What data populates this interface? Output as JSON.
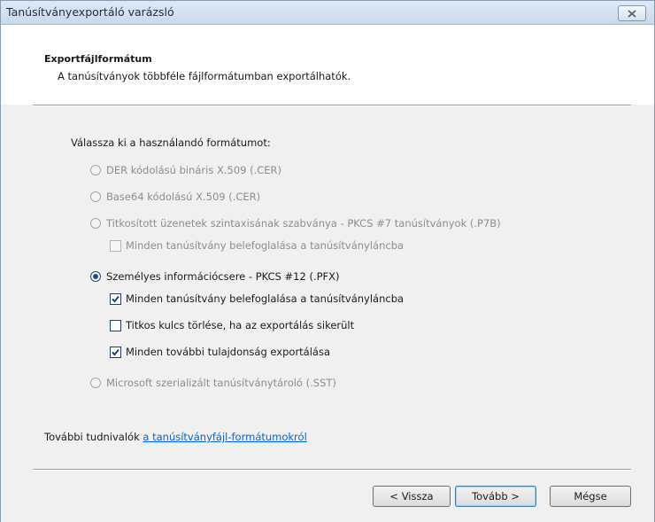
{
  "window": {
    "title": "Tanúsítványexportáló varázsló"
  },
  "header": {
    "title": "Exportfájlformátum",
    "description": "A tanúsítványok többféle fájlformátumban exportálhatók."
  },
  "form": {
    "prompt": "Válassza ki a használandó formátumot:",
    "options": [
      {
        "label": "DER kódolású bináris X.509 (.CER)",
        "enabled": false,
        "selected": false
      },
      {
        "label": "Base64 kódolású X.509 (.CER)",
        "enabled": false,
        "selected": false
      },
      {
        "label": "Titkosított üzenetek szintaxisának szabványa - PKCS #7 tanúsítványok (.P7B)",
        "enabled": false,
        "selected": false
      },
      {
        "label": "Személyes információcsere - PKCS #12 (.PFX)",
        "enabled": true,
        "selected": true
      },
      {
        "label": "Microsoft szerializált tanúsítványtároló (.SST)",
        "enabled": false,
        "selected": false
      }
    ],
    "checkboxes": [
      {
        "label": "Minden tanúsítvány belefoglalása a tanúsítványláncba",
        "enabled": false,
        "checked": false
      },
      {
        "label": "Minden tanúsítvány belefoglalása a tanúsítványláncba",
        "enabled": true,
        "checked": true
      },
      {
        "label": "Titkos kulcs törlése, ha az exportálás sikerült",
        "enabled": true,
        "checked": false
      },
      {
        "label": "Minden további tulajdonság exportálása",
        "enabled": true,
        "checked": true
      }
    ]
  },
  "footer": {
    "more_info_prefix": "További tudnivalók",
    "more_info_link": "a tanúsítványfájl-formátumokról"
  },
  "buttons": {
    "back": "< Vissza",
    "next": "Tovább >",
    "cancel": "Mégse"
  },
  "colors": {
    "link": "#0066cc",
    "accent": "#1a4e9a"
  }
}
